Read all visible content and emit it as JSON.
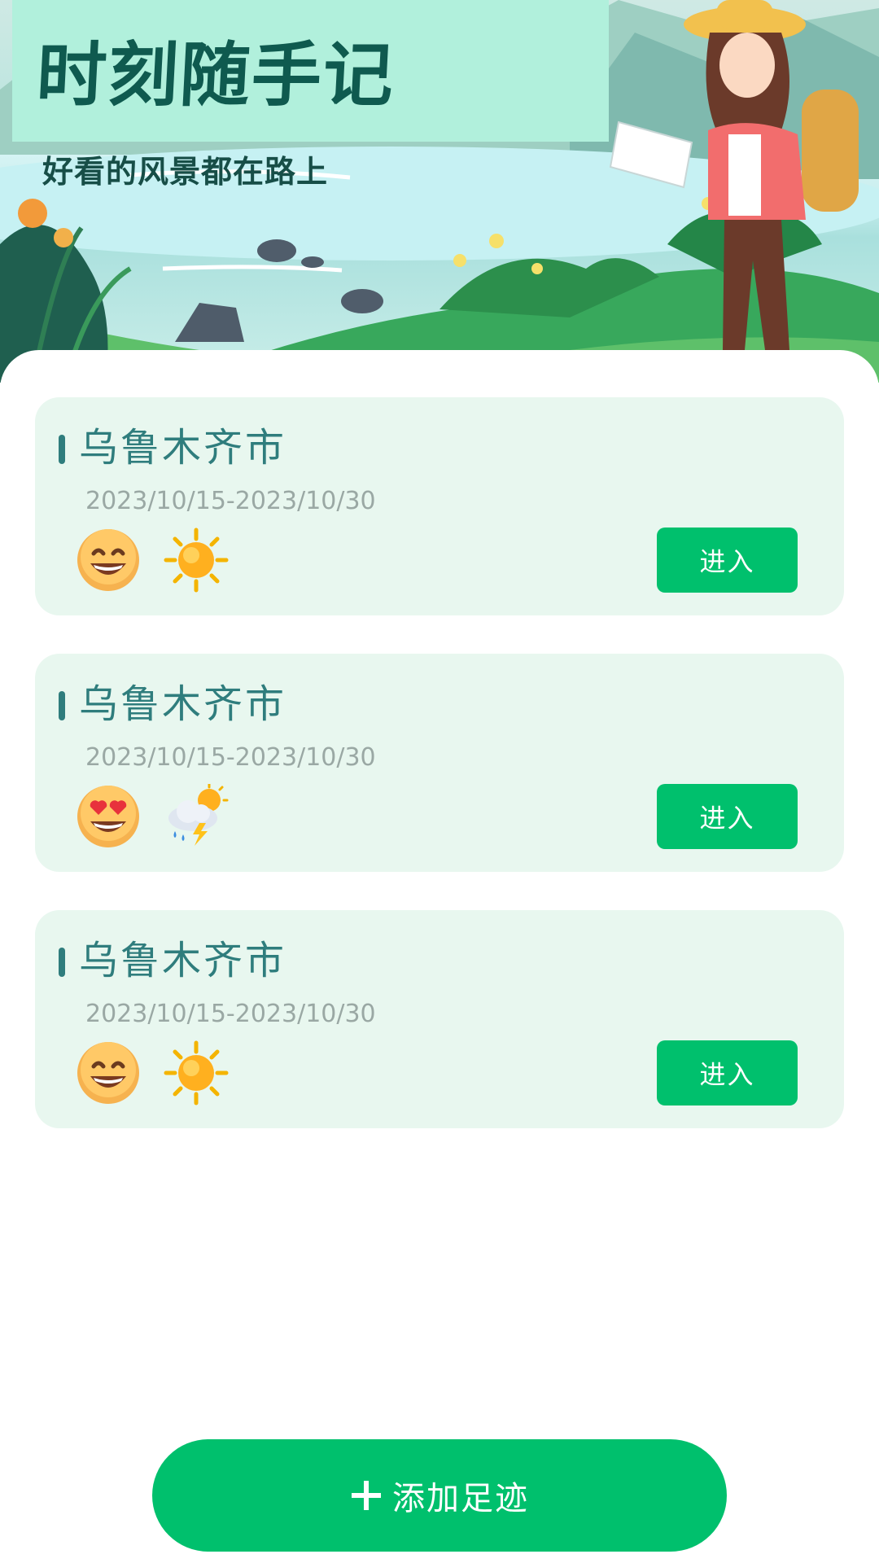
{
  "header": {
    "title": "时刻随手记",
    "subtitle": "好看的风景都在路上"
  },
  "trips": [
    {
      "city": "乌鲁木齐市",
      "date_range": "2023/10/15-2023/10/30",
      "mood_icon": "grinning-face-icon",
      "weather_icon": "sun-icon",
      "enter_label": "进入"
    },
    {
      "city": "乌鲁木齐市",
      "date_range": "2023/10/15-2023/10/30",
      "mood_icon": "heart-eyes-face-icon",
      "weather_icon": "thunderstorm-cloud-sun-icon",
      "enter_label": "进入"
    },
    {
      "city": "乌鲁木齐市",
      "date_range": "2023/10/15-2023/10/30",
      "mood_icon": "grinning-face-icon",
      "weather_icon": "sun-icon",
      "enter_label": "进入"
    }
  ],
  "footer": {
    "add_label": "添加足迹"
  },
  "colors": {
    "primary": "#00c06d",
    "card_bg": "#e8f7ef",
    "city_text": "#2f7d7d",
    "date_text": "#9aa8a4",
    "title_bg": "#b1f0dc",
    "title_text": "#0f5a4f"
  }
}
